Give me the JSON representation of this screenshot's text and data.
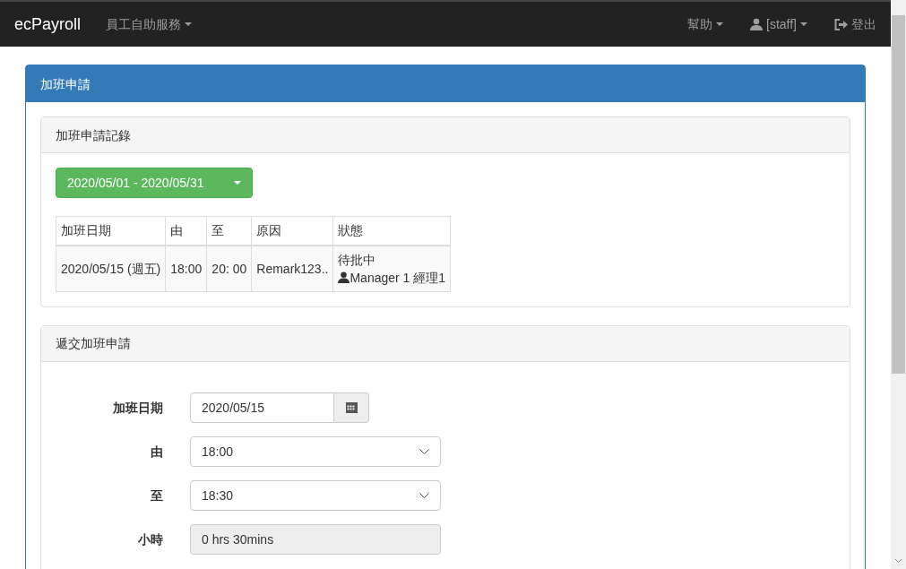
{
  "navbar": {
    "brand": "ecPayroll",
    "menu": [
      {
        "label": "員工自助服務",
        "kind": "dropdown"
      }
    ],
    "right": [
      {
        "label": "幫助",
        "kind": "dropdown"
      },
      {
        "label": "[staff]",
        "kind": "user-menu"
      },
      {
        "label": "登出",
        "kind": "logout"
      }
    ]
  },
  "panel": {
    "title": "加班申請",
    "records": {
      "title": "加班申請記錄",
      "date_range": "2020/05/01 - 2020/05/31",
      "table": {
        "columns": [
          "加班日期",
          "由",
          "至",
          "原因",
          "狀態"
        ],
        "rows": [
          {
            "date": "2020/05/15 (週五)",
            "from": "18:00",
            "to": "20: 00",
            "reason": "Remark123..",
            "status": "待批中",
            "approver": "Manager 1 經理1"
          }
        ]
      }
    },
    "form": {
      "title": "遞交加班申請",
      "fields": [
        {
          "label": "加班日期",
          "kind": "date",
          "value": "2020/05/15"
        },
        {
          "label": "由",
          "kind": "select",
          "value": "18:00"
        },
        {
          "label": "至",
          "kind": "select",
          "value": "18:30"
        },
        {
          "label": "小時",
          "kind": "readonly",
          "value": "0 hrs 30mins"
        }
      ]
    }
  }
}
